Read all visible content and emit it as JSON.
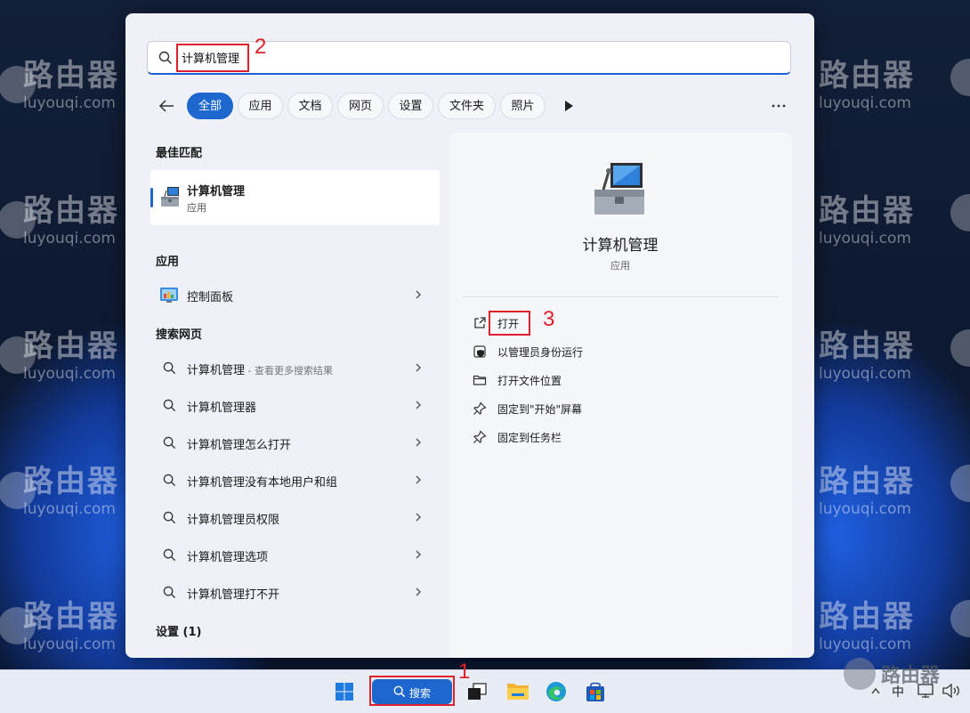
{
  "watermark": {
    "cn": "路由器",
    "en": "luyouqi.com"
  },
  "search": {
    "value": "计算机管理",
    "icon": "search-icon"
  },
  "annotations": [
    "1",
    "2",
    "3"
  ],
  "filters": {
    "chips": [
      "全部",
      "应用",
      "文档",
      "网页",
      "设置",
      "文件夹",
      "照片"
    ],
    "active_index": 0
  },
  "left": {
    "best_match_title": "最佳匹配",
    "best_match": {
      "name": "计算机管理",
      "kind": "应用"
    },
    "apps_title": "应用",
    "apps": [
      {
        "name": "控制面板"
      }
    ],
    "web_title": "搜索网页",
    "web_first": {
      "name": "计算机管理",
      "sub": " - 查看更多搜索结果"
    },
    "web_results": [
      "计算机管理器",
      "计算机管理怎么打开",
      "计算机管理没有本地用户和组",
      "计算机管理员权限",
      "计算机管理选项",
      "计算机管理打不开"
    ],
    "settings_title": "设置 (1)"
  },
  "detail": {
    "title": "计算机管理",
    "kind": "应用",
    "actions": [
      {
        "label": "打开",
        "icon": "open-external-icon"
      },
      {
        "label": "以管理员身份运行",
        "icon": "shield-icon"
      },
      {
        "label": "打开文件位置",
        "icon": "folder-icon"
      },
      {
        "label": "固定到\"开始\"屏幕",
        "icon": "pin-icon"
      },
      {
        "label": "固定到任务栏",
        "icon": "pin-icon"
      }
    ]
  },
  "taskbar": {
    "search_label": "搜索",
    "ime": "中",
    "tray_watermark": "路由器"
  },
  "colors": {
    "accent": "#1e67cf",
    "annotation": "#e0202a",
    "panel": "#eef1f8"
  }
}
